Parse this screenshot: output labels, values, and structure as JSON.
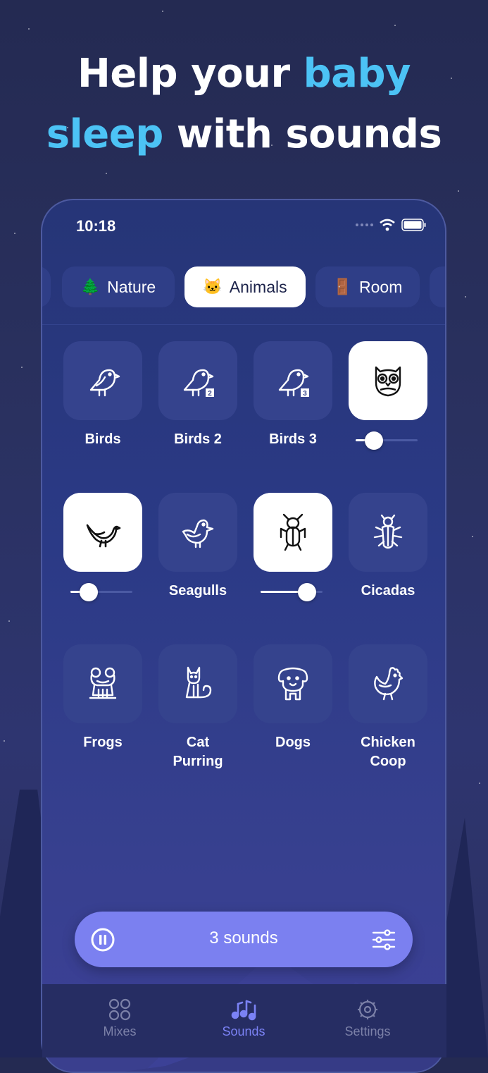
{
  "headline": {
    "line1_plain": "Help your ",
    "line1_accent": "baby",
    "line2_accent": "sleep",
    "line2_plain": " with sounds"
  },
  "status_bar": {
    "time": "10:18"
  },
  "category_tabs": [
    {
      "emoji": "🌲",
      "label": "Nature",
      "active": false
    },
    {
      "emoji": "🐱",
      "label": "Animals",
      "active": true
    },
    {
      "emoji": "🚪",
      "label": "Room",
      "active": false
    }
  ],
  "sounds": [
    {
      "label": "Birds",
      "icon": "bird-icon",
      "active": false
    },
    {
      "label": "Birds 2",
      "icon": "bird-2-icon",
      "active": false
    },
    {
      "label": "Birds 3",
      "icon": "bird-3-icon",
      "active": false
    },
    {
      "label": "",
      "icon": "owl-icon",
      "active": true,
      "volume": 0.3
    },
    {
      "label": "",
      "icon": "songbird-icon",
      "active": true,
      "volume": 0.3
    },
    {
      "label": "Seagulls",
      "icon": "seagull-icon",
      "active": false
    },
    {
      "label": "",
      "icon": "cricket-icon",
      "active": true,
      "volume": 0.75
    },
    {
      "label": "Cicadas",
      "icon": "cicada-icon",
      "active": false
    },
    {
      "label": "Frogs",
      "icon": "frog-icon",
      "active": false
    },
    {
      "label": "Cat\nPurring",
      "icon": "cat-icon",
      "active": false
    },
    {
      "label": "Dogs",
      "icon": "dog-icon",
      "active": false
    },
    {
      "label": "Chicken\nCoop",
      "icon": "chicken-icon",
      "active": false
    }
  ],
  "player": {
    "text": "3 sounds",
    "pause_icon": "pause-icon",
    "mixer_icon": "mixer-icon"
  },
  "nav": [
    {
      "label": "Mixes",
      "icon": "grid-circles-icon",
      "active": false
    },
    {
      "label": "Sounds",
      "icon": "music-notes-icon",
      "active": true
    },
    {
      "label": "Settings",
      "icon": "gear-icon",
      "active": false
    }
  ],
  "colors": {
    "accent": "#4cc3f5",
    "player": "#7b80f0",
    "nav_active": "#7b82f5"
  }
}
